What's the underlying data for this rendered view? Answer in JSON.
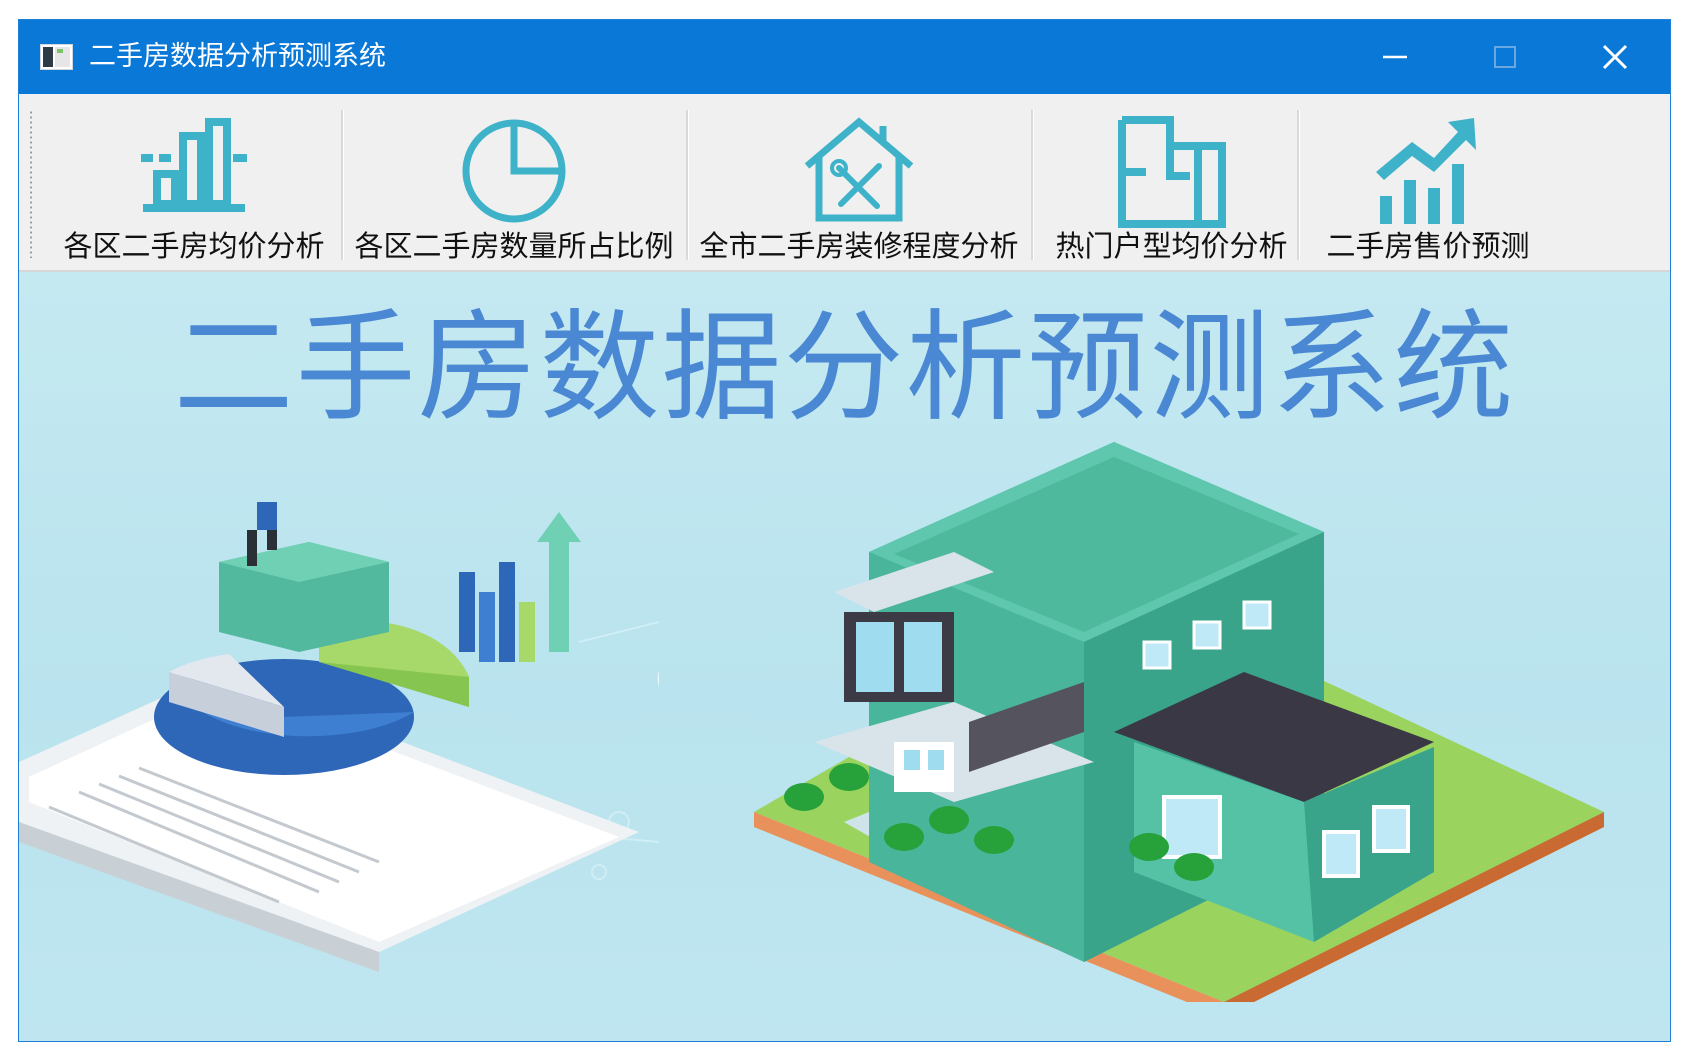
{
  "window": {
    "title": "二手房数据分析预测系统",
    "accent_color": "#0a78d7"
  },
  "titlebar_buttons": {
    "minimize_icon": "minimize-icon",
    "maximize_icon": "maximize-icon",
    "close_icon": "close-icon"
  },
  "toolbar": {
    "icon_color": "#3eb2c9",
    "items": [
      {
        "label": "各区二手房均价分析",
        "icon": "bar-chart-icon"
      },
      {
        "label": "各区二手房数量所占比例",
        "icon": "pie-chart-icon"
      },
      {
        "label": "全市二手房装修程度分析",
        "icon": "house-tools-icon"
      },
      {
        "label": "热门户型均价分析",
        "icon": "floor-plan-icon"
      },
      {
        "label": "二手房售价预测",
        "icon": "trend-up-icon"
      }
    ]
  },
  "banner": {
    "title": "二手房数据分析预测系统",
    "title_color": "#4a88d4"
  }
}
